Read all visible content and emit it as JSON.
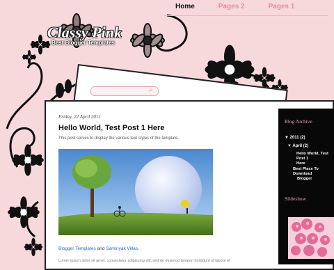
{
  "nav": {
    "items": [
      {
        "label": "Home"
      },
      {
        "label": "Pages 2"
      },
      {
        "label": "Pages 1"
      }
    ]
  },
  "site": {
    "title": "Classy Pink",
    "description": "Best Blogger Templates"
  },
  "post": {
    "date": "Friday, 22 April 2011",
    "title": "Hello World, Test Post 1 Here",
    "description": "This post serves to display the various text styles of the template.",
    "credits": {
      "link1": "Blogger Templates",
      "and": "and",
      "link2": "Saminyak Villas."
    }
  },
  "sidebar": {
    "archive_title": "Blog Archive",
    "archive": {
      "year": "2011 (2)",
      "month": "April (2)",
      "post1_line1": "Hello World, Test Post 1",
      "post1_line2": "Here",
      "post2_line1": "Best Place To Download",
      "post2_line2": "Blogger"
    },
    "slideshow_title": "Slideshow"
  },
  "colors": {
    "background": "#f7d9dc",
    "accent": "#e28e9b",
    "sidebar_bg": "#080808",
    "sidebar_title": "#f5a8bc"
  }
}
